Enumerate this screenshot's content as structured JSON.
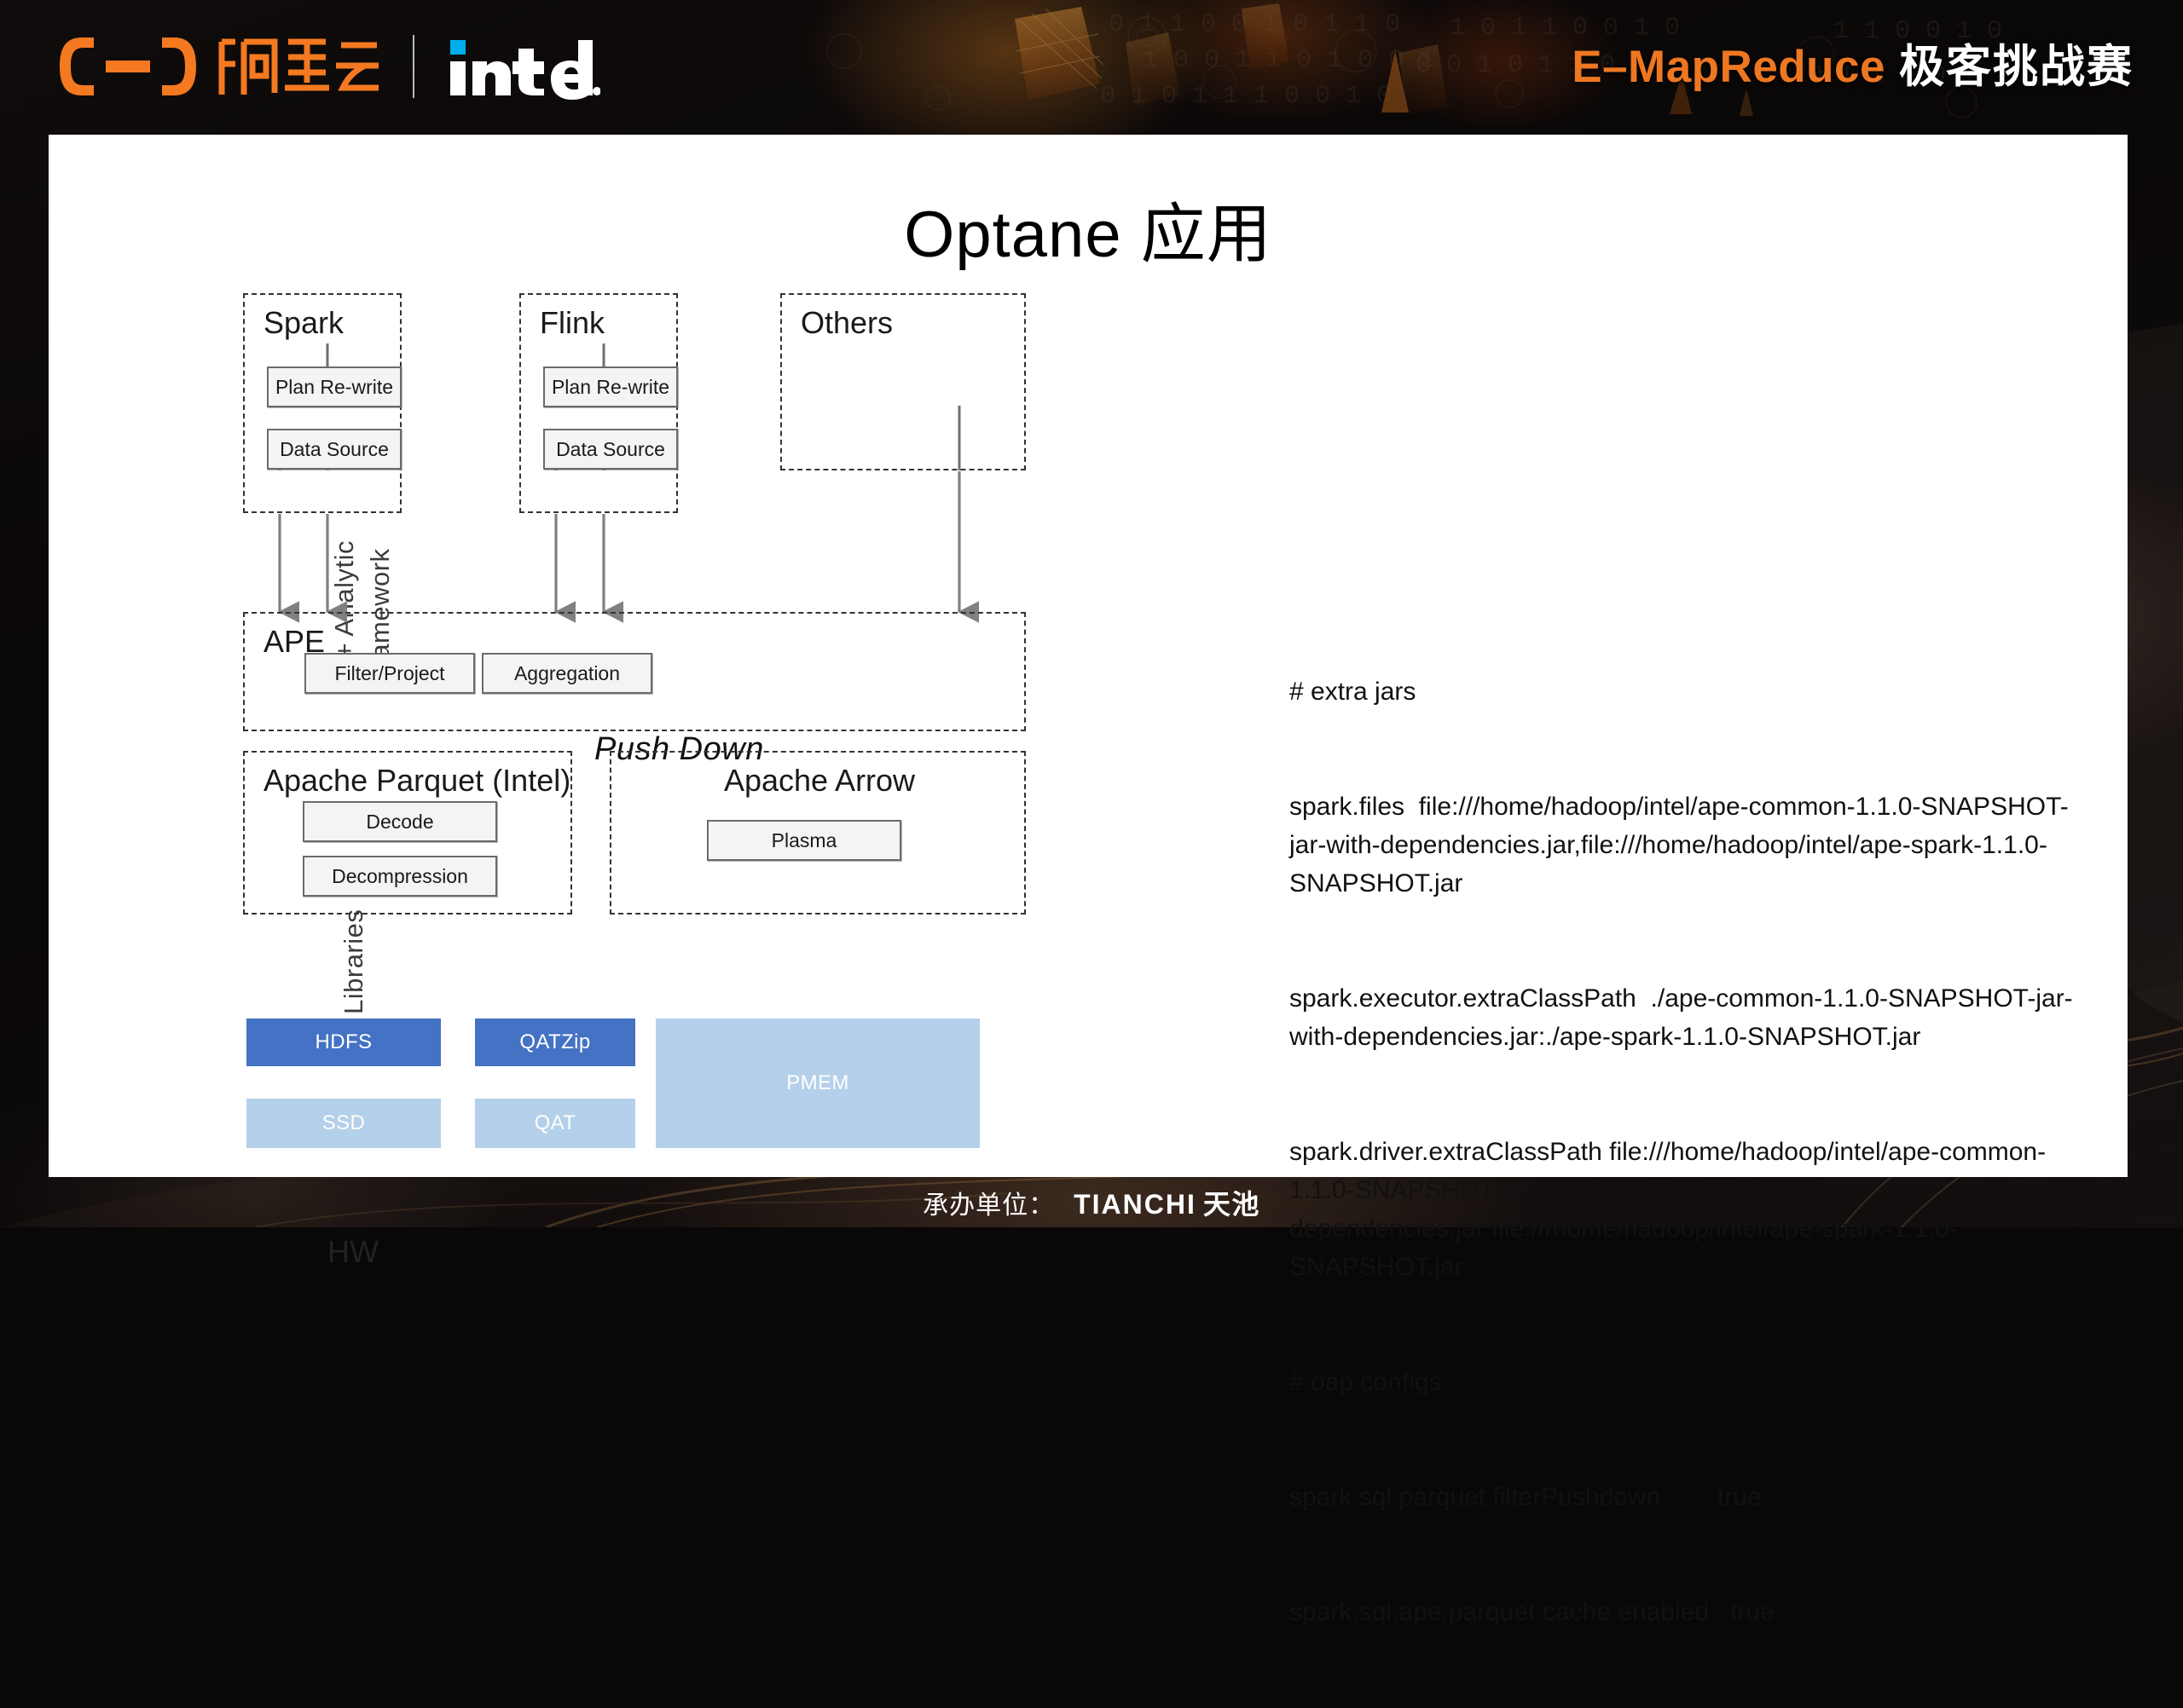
{
  "header": {
    "alibaba_logo_alt": "阿里云",
    "alibaba_cn": "阿里云",
    "intel_logo_alt": "intel",
    "event_title_en": "E–MapReduce",
    "event_title_cn": "极客挑战赛",
    "accent_orange": "#ee7722"
  },
  "slide": {
    "title": "Optane 应用",
    "side_labels": {
      "ai_line1": "AI + Analytic",
      "ai_line2": "Framework",
      "libraries": "Libraries",
      "hw": "HW"
    },
    "pushdown_label": "Push Down",
    "frameworks": [
      {
        "title": "Spark",
        "items": [
          "Plan Re-write",
          "Data Source"
        ]
      },
      {
        "title": "Flink",
        "items": [
          "Plan Re-write",
          "Data Source"
        ]
      },
      {
        "title": "Others",
        "items": []
      }
    ],
    "ape": {
      "title": "APE",
      "items": [
        "Filter/Project",
        "Aggregation"
      ]
    },
    "libraries_groups": [
      {
        "title": "Apache Parquet (Intel)",
        "items": [
          "Decode",
          "Decompression"
        ]
      },
      {
        "title": "Apache Arrow",
        "items": [
          "Plasma"
        ]
      }
    ],
    "hardware": {
      "row_top": [
        {
          "label": "HDFS",
          "color": "#4472c4",
          "style": "dark"
        },
        {
          "label": "QATZip",
          "color": "#4472c4",
          "style": "dark"
        }
      ],
      "row_bottom": [
        {
          "label": "SSD",
          "color": "#b4d0ea",
          "style": "light"
        },
        {
          "label": "QAT",
          "color": "#b4d0ea",
          "style": "light"
        }
      ],
      "tall": {
        "label": "PMEM",
        "color": "#b4d0ea",
        "style": "light"
      }
    },
    "config_lines": [
      "# extra jars",
      "spark.files  file:///home/hadoop/intel/ape-common-1.1.0-SNAPSHOT-jar-with-dependencies.jar,file:///home/hadoop/intel/ape-spark-1.1.0-SNAPSHOT.jar",
      "spark.executor.extraClassPath  ./ape-common-1.1.0-SNAPSHOT-jar-with-dependencies.jar:./ape-spark-1.1.0-SNAPSHOT.jar",
      "spark.driver.extraClassPath file:///home/hadoop/intel/ape-common-1.1.0-SNAPSHOT-jar-with-dependencies.jar:file:///home/hadoop/intel/ape-spark-1.1.0-SNAPSHOT.jar",
      "# oap configs",
      "spark.sql.parquet.filterPushdown        true",
      "spark.sql.ape.parquet.cache.enabled   true"
    ]
  },
  "footer": {
    "organizer_label": "承办单位：",
    "brand_en": "TIANCHI",
    "brand_cn": "天池"
  }
}
